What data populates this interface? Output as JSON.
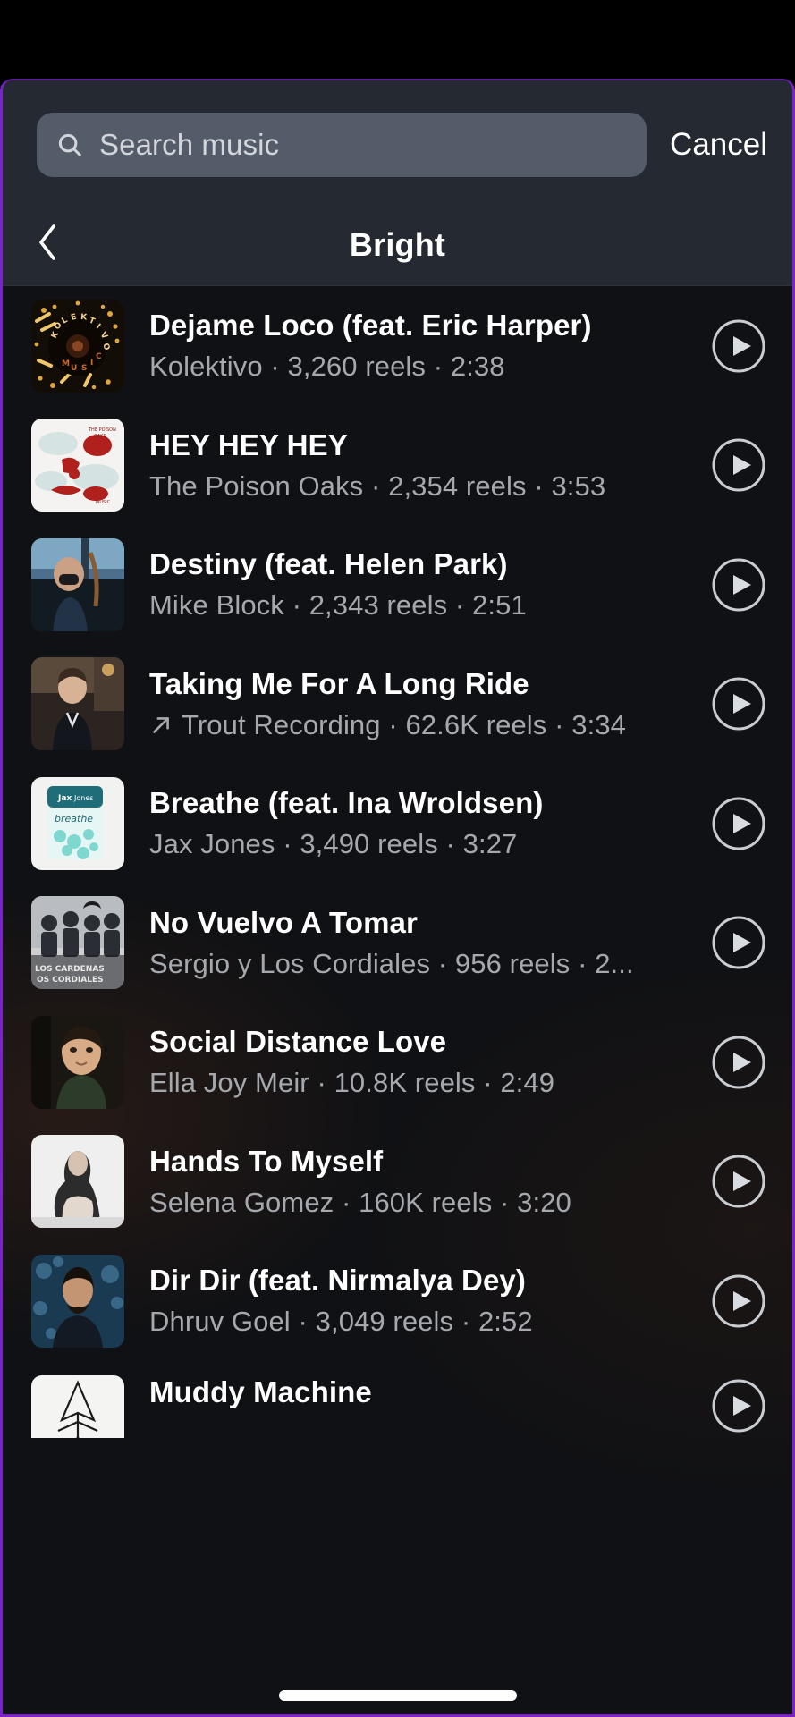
{
  "search": {
    "placeholder": "Search music",
    "value": "",
    "icon": "search-icon",
    "cancel_label": "Cancel"
  },
  "header": {
    "back_icon": "chevron-left-icon",
    "title": "Bright"
  },
  "colors": {
    "sheet_bg": "#121417",
    "list_bg": "#101114",
    "header_bg": "#242932",
    "search_field_bg": "#555c69",
    "title_text": "#ffffff",
    "subtitle_text": "#a5a9ae",
    "accent_border": "#7b23c9"
  },
  "list": {
    "play_icon": "play-circle-icon",
    "trending_icon": "arrow-up-right-icon",
    "tracks": [
      {
        "title": "Dejame Loco (feat. Eric Harper)",
        "artist": "Kolektivo",
        "reels": "3,260 reels",
        "duration": "2:38",
        "subtitle": "Kolektivo · 3,260 reels · 2:38",
        "trending": false,
        "artwork": "kolektivo-music-sunburst"
      },
      {
        "title": "HEY HEY HEY",
        "artist": "The Poison Oaks",
        "reels": "2,354 reels",
        "duration": "3:53",
        "subtitle": "The Poison Oaks · 2,354 reels · 3:53",
        "trending": false,
        "artwork": "red-ink-illustration-white"
      },
      {
        "title": "Destiny (feat. Helen Park)",
        "artist": "Mike Block",
        "reels": "2,343 reels",
        "duration": "2:51",
        "subtitle": "Mike Block · 2,343 reels · 2:51",
        "trending": false,
        "artwork": "man-with-cello-window"
      },
      {
        "title": "Taking Me For A Long Ride",
        "artist": "Trout Recording",
        "reels": "62.6K reels",
        "duration": "3:34",
        "subtitle": "Trout Recording · 62.6K reels · 3:34",
        "trending": true,
        "artwork": "man-dark-shirt-studio"
      },
      {
        "title": "Breathe (feat. Ina Wroldsen)",
        "artist": "Jax Jones",
        "reels": "3,490 reels",
        "duration": "3:27",
        "subtitle": "Jax Jones · 3,490 reels · 3:27",
        "trending": false,
        "artwork": "breathe-mint-packet"
      },
      {
        "title": "No Vuelvo A Tomar",
        "artist": "Sergio y Los Cordiales",
        "reels": "956 reels",
        "duration": "2...",
        "subtitle": "Sergio y Los Cordiales · 956 reels · 2...",
        "trending": false,
        "artwork": "band-group-bw-photo"
      },
      {
        "title": "Social Distance Love",
        "artist": "Ella Joy Meir",
        "reels": "10.8K reels",
        "duration": "2:49",
        "subtitle": "Ella Joy Meir · 10.8K reels · 2:49",
        "trending": false,
        "artwork": "woman-portrait-dark"
      },
      {
        "title": "Hands To Myself",
        "artist": "Selena Gomez",
        "reels": "160K reels",
        "duration": "3:20",
        "subtitle": "Selena Gomez · 160K reels · 3:20",
        "trending": false,
        "artwork": "woman-seated-white-bg"
      },
      {
        "title": "Dir Dir (feat. Nirmalya Dey)",
        "artist": "Dhruv Goel",
        "reels": "3,049 reels",
        "duration": "2:52",
        "subtitle": "Dhruv Goel · 3,049 reels · 2:52",
        "trending": false,
        "artwork": "man-blue-bokeh"
      },
      {
        "title": "Muddy Machine",
        "artist": "",
        "reels": "",
        "duration": "",
        "subtitle": "",
        "trending": false,
        "artwork": "white-sketch-cover"
      }
    ]
  }
}
